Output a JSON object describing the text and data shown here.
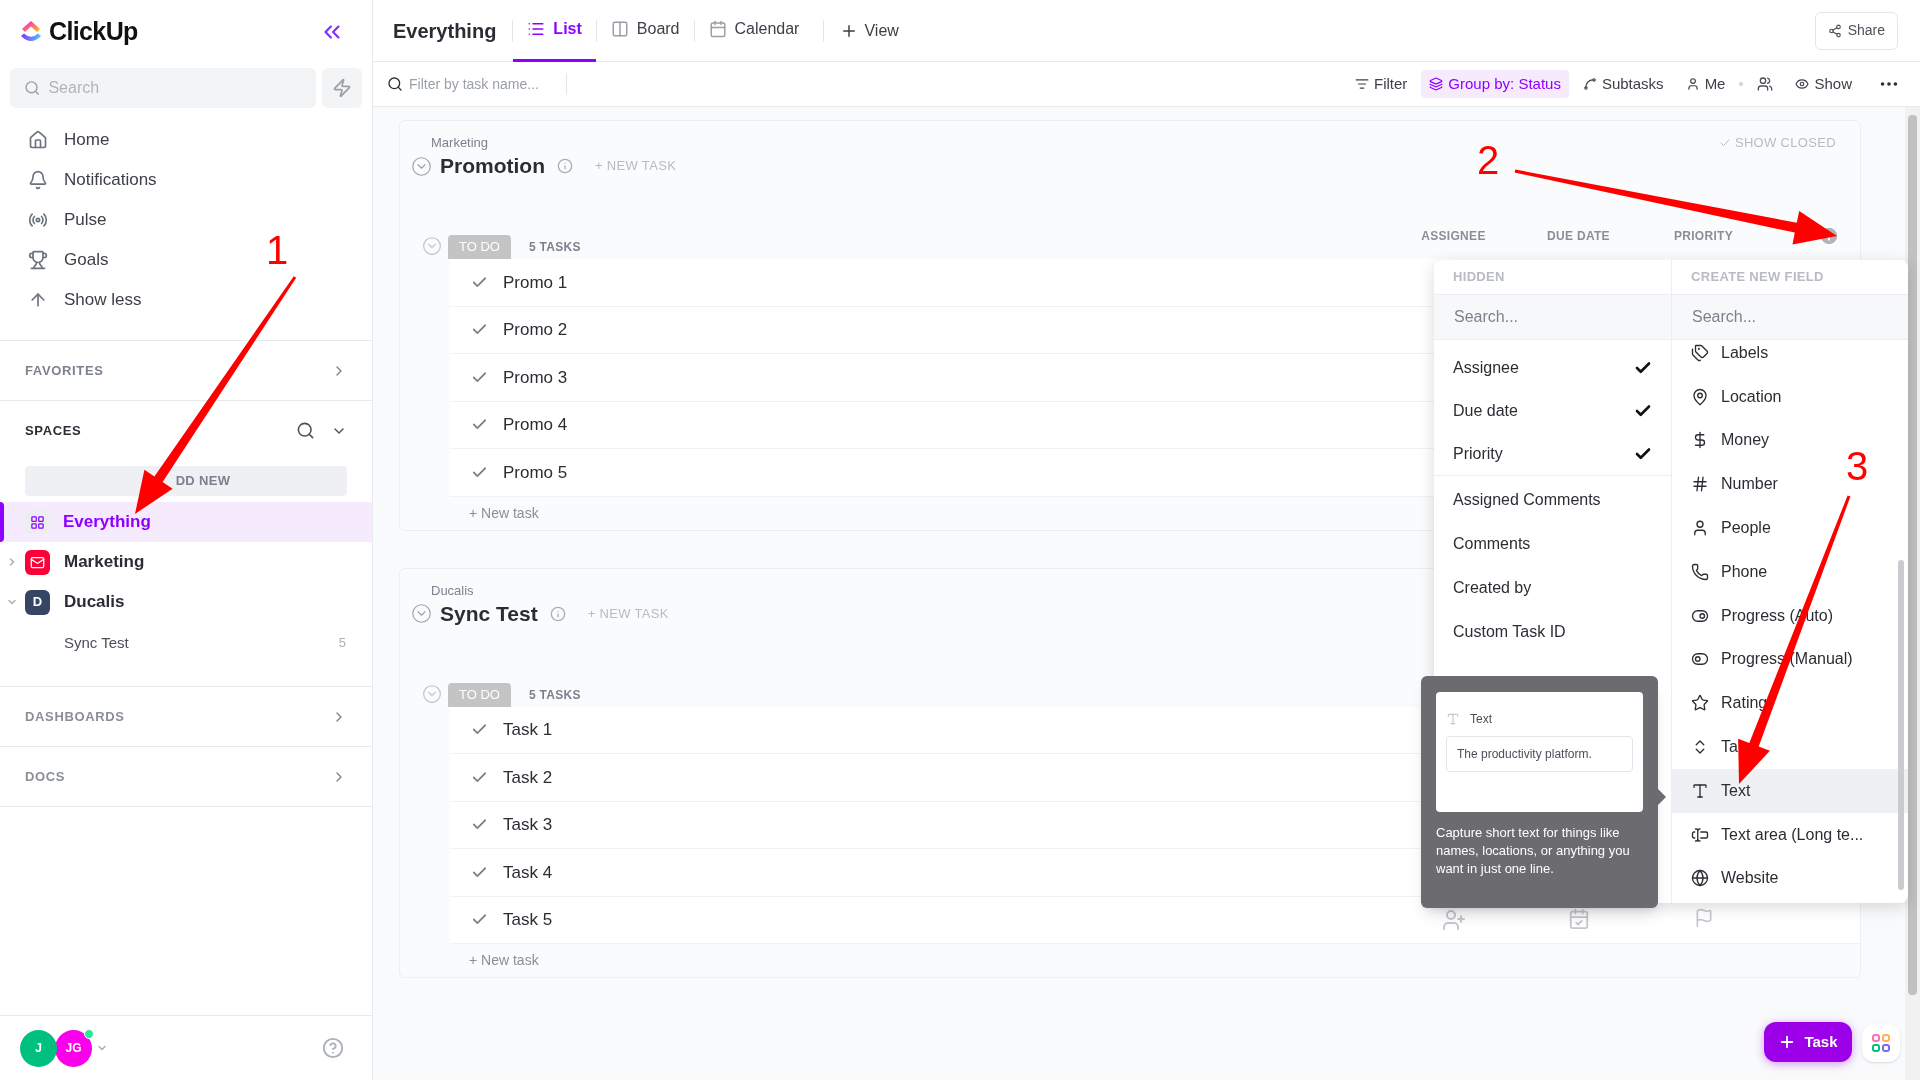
{
  "sidebar": {
    "logo": "ClickUp",
    "search": {
      "placeholder": "Search"
    },
    "nav": [
      {
        "label": "Home"
      },
      {
        "label": "Notifications"
      },
      {
        "label": "Pulse"
      },
      {
        "label": "Goals"
      },
      {
        "label": "Show less"
      }
    ],
    "favorites": "FAVORITES",
    "spaces_title": "SPACES",
    "add_new": "DD NEW",
    "spaces": [
      {
        "label": "Everything",
        "kind": "everything",
        "selected": true
      },
      {
        "label": "Marketing",
        "kind": "icon",
        "color": "#fd0038",
        "expanded": false,
        "selected": false
      },
      {
        "label": "Ducalis",
        "kind": "letter",
        "badge": "D",
        "color": "#364563",
        "expanded": true,
        "selected": false,
        "children": [
          {
            "label": "Sync Test",
            "count": "5"
          }
        ]
      }
    ],
    "sections": [
      "DASHBOARDS",
      "DOCS"
    ],
    "avatars": [
      {
        "initials": "J",
        "color": "#00c07f",
        "online": false
      },
      {
        "initials": "JG",
        "color": "#f900ea",
        "online": true
      }
    ]
  },
  "header": {
    "title": "Everything",
    "views": [
      {
        "label": "List",
        "selected": true
      },
      {
        "label": "Board",
        "selected": false
      },
      {
        "label": "Calendar",
        "selected": false
      }
    ],
    "add_view": "View",
    "share": "Share"
  },
  "toolbar": {
    "filter": {
      "placeholder": "Filter by task name..."
    },
    "buttons": [
      {
        "label": "Filter",
        "active": false
      },
      {
        "label": "Group by: Status",
        "active": true
      },
      {
        "label": "Subtasks",
        "active": false
      },
      {
        "label": "Me",
        "active": false
      },
      {
        "label": "Show",
        "active": false
      }
    ]
  },
  "groups": [
    {
      "space": "Marketing",
      "title": "Promotion",
      "new_task": "+ NEW TASK",
      "show_closed": "SHOW CLOSED",
      "status": "TO DO",
      "count": "5 TASKS",
      "columns": [
        "ASSIGNEE",
        "DUE DATE",
        "PRIORITY"
      ],
      "tasks": [
        {
          "name": "Promo 1"
        },
        {
          "name": "Promo 2"
        },
        {
          "name": "Promo 3"
        },
        {
          "name": "Promo 4"
        },
        {
          "name": "Promo 5"
        }
      ],
      "add_task": "+ New task"
    },
    {
      "space": "Ducalis",
      "title": "Sync Test",
      "new_task": "+ NEW TASK",
      "status": "TO DO",
      "count": "5 TASKS",
      "tasks": [
        {
          "name": "Task 1"
        },
        {
          "name": "Task 2"
        },
        {
          "name": "Task 3"
        },
        {
          "name": "Task 4"
        },
        {
          "name": "Task 5",
          "field_icons": true
        }
      ],
      "add_task": "+ New task"
    }
  ],
  "field_picker": {
    "hidden_title": "HIDDEN",
    "create_title": "CREATE NEW FIELD",
    "hidden_search": {
      "placeholder": "Search..."
    },
    "create_search": {
      "placeholder": "Search..."
    },
    "shown_fields": [
      {
        "label": "Assignee",
        "checked": true
      },
      {
        "label": "Due date",
        "checked": true
      },
      {
        "label": "Priority",
        "checked": true
      }
    ],
    "hidden_fields": [
      {
        "label": "Assigned Comments"
      },
      {
        "label": "Comments"
      },
      {
        "label": "Created by"
      },
      {
        "label": "Custom Task ID"
      }
    ],
    "new_fields": [
      {
        "label": "Labels",
        "kind": "labels",
        "selected": false
      },
      {
        "label": "Location",
        "kind": "location",
        "selected": false
      },
      {
        "label": "Money",
        "kind": "money",
        "selected": false
      },
      {
        "label": "Number",
        "kind": "number",
        "selected": false
      },
      {
        "label": "People",
        "kind": "people",
        "selected": false
      },
      {
        "label": "Phone",
        "kind": "phone",
        "selected": false
      },
      {
        "label": "Progress (Auto)",
        "kind": "progress_auto",
        "selected": false
      },
      {
        "label": "Progress (Manual)",
        "kind": "progress_manual",
        "selected": false
      },
      {
        "label": "Rating",
        "kind": "rating",
        "selected": false
      },
      {
        "label": "Ta",
        "kind": "tags",
        "selected": false
      },
      {
        "label": "Text",
        "kind": "text",
        "selected": true
      },
      {
        "label": "Text area (Long te...",
        "kind": "text_area",
        "selected": false
      },
      {
        "label": "Website",
        "kind": "website",
        "selected": false
      }
    ]
  },
  "tooltip": {
    "label": "Text",
    "example": "The productivity platform.",
    "description": "Capture short text for things like names, locations, or anything you want in just one line."
  },
  "fab": {
    "label": "Task"
  },
  "annotations": [
    "1",
    "2",
    "3"
  ]
}
